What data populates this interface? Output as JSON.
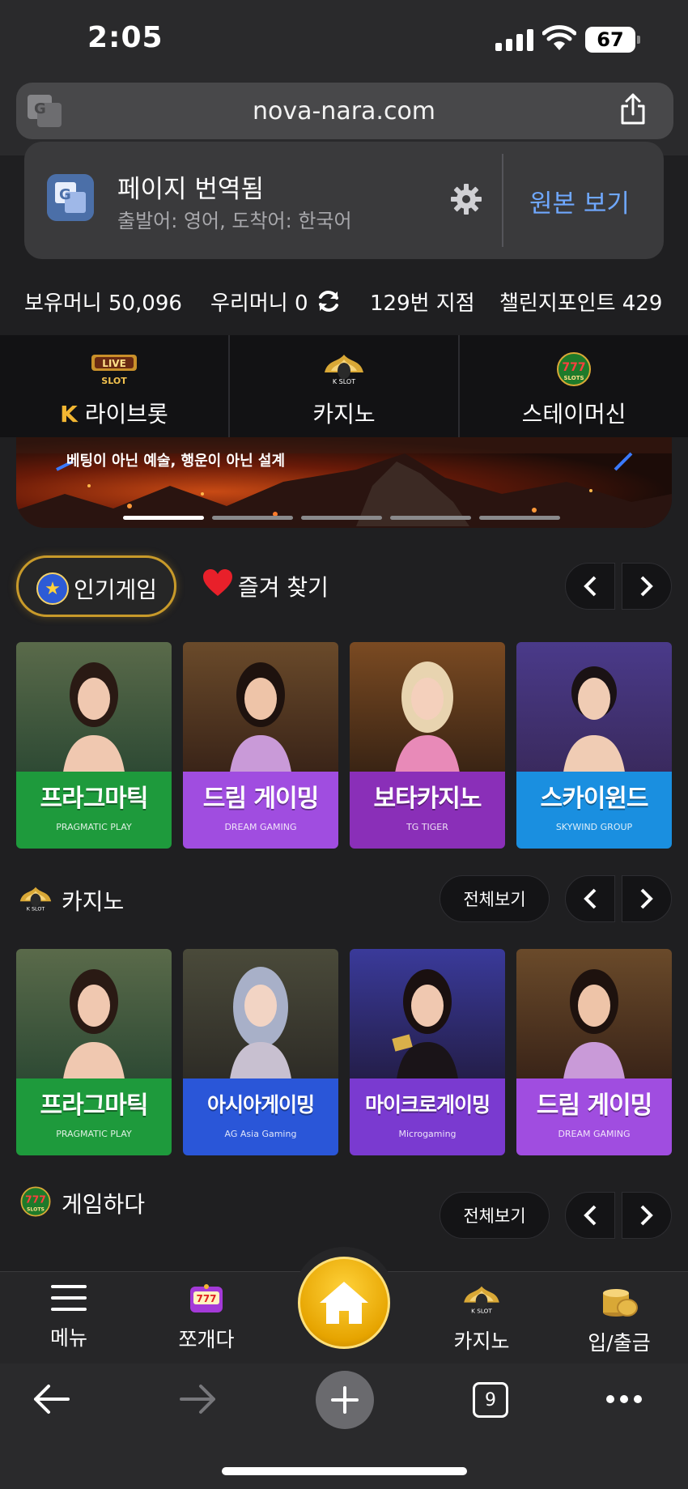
{
  "status": {
    "time": "2:05",
    "battery": "67"
  },
  "browser": {
    "url": "nova-nara.com",
    "tab_count": "9"
  },
  "translate": {
    "title": "페이지 번역됨",
    "subtitle": "출발어: 영어, 도착어: 한국어",
    "view_original": "원본 보기"
  },
  "balances": {
    "owned_money": "보유머니 50,096",
    "our_money": "우리머니 0",
    "branch": "129번 지점",
    "challenge_points": "챌린지포인트 429"
  },
  "categories": [
    {
      "label": "라이브롯",
      "icon": "live-slot-icon"
    },
    {
      "label": "카지노",
      "icon": "k-slot-crown-icon"
    },
    {
      "label": "스테이머신",
      "icon": "777-slots-icon"
    }
  ],
  "banner": {
    "text": "베팅이 아닌 예술, 행운이 아닌 설계",
    "slides": 5,
    "active_slide": 1
  },
  "popular": {
    "tab_popular": "인기게임",
    "tab_favorites": "즐겨 찾기",
    "cards": [
      {
        "title": "프라그마틱",
        "brand": "PRAGMATIC PLAY",
        "band": "#1e9a3c",
        "bg": "#3c5a3e"
      },
      {
        "title": "드림 게이밍",
        "brand": "DREAM GAMING",
        "band": "#a04de0",
        "bg": "#4a3428"
      },
      {
        "title": "보타카지노",
        "brand": "TG TIGER",
        "band": "#8a2fb8",
        "bg": "#5a3a22"
      },
      {
        "title": "스카이윈드",
        "brand": "SKYWIND GROUP",
        "band": "#1a8fe0",
        "bg": "#3e2a5e"
      }
    ]
  },
  "casino": {
    "title": "카지노",
    "view_all": "전체보기",
    "cards": [
      {
        "title": "프라그마틱",
        "brand": "PRAGMATIC PLAY",
        "band": "#1e9a3c",
        "bg": "#3c5a3e"
      },
      {
        "title": "아시아게이밍",
        "brand": "AG Asia Gaming",
        "band": "#2a56d8",
        "bg": "#3a3830"
      },
      {
        "title": "마이크로게이밍",
        "brand": "Microgaming",
        "band": "#7a3ad0",
        "bg": "#2a2050"
      },
      {
        "title": "드림 게이밍",
        "brand": "DREAM GAMING",
        "band": "#a04de0",
        "bg": "#4a3428"
      }
    ]
  },
  "slots": {
    "title": "게임하다",
    "view_all": "전체보기"
  },
  "bottom_nav": {
    "menu": "메뉴",
    "slot": "쪼개다",
    "casino": "카지노",
    "deposit": "입/출금"
  }
}
